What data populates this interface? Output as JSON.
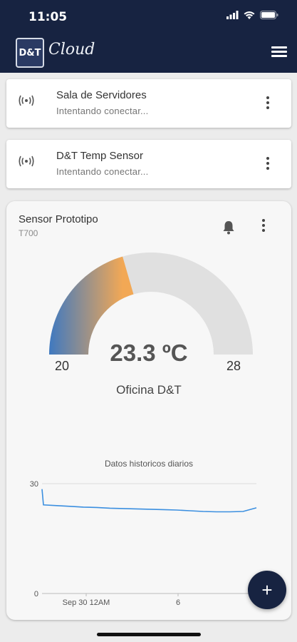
{
  "status_bar": {
    "time": "11:05"
  },
  "app": {
    "title": "Cloud",
    "logo_text": "D&T"
  },
  "devices": [
    {
      "name": "Sala de Servidores",
      "status": "Intentando conectar..."
    },
    {
      "name": "D&T Temp Sensor",
      "status": "Intentando conectar..."
    }
  ],
  "sensor": {
    "name": "Sensor Prototipo",
    "model": "T700",
    "gauge": {
      "min": "20",
      "max": "28",
      "value": "23.3 ºC",
      "fill_fraction": 0.41
    },
    "location": "Oficina D&T",
    "colors": {
      "gauge_cold": "#3f79c0",
      "gauge_warm": "#f2a855",
      "gauge_track": "#e0e0e0",
      "accent": "#172341"
    }
  },
  "chart_data": {
    "type": "line",
    "title": "Datos historicos diarios",
    "ylim": [
      0,
      30
    ],
    "y_ticks": [
      "30",
      "0"
    ],
    "x_ticks": [
      "Sep 30 12AM",
      "6"
    ],
    "series": [
      {
        "color": "#3b8fe0",
        "values": [
          28.5,
          24.2,
          24.0,
          23.8,
          23.6,
          23.5,
          23.3,
          23.2,
          23.1,
          23.0,
          22.9,
          22.8,
          22.6,
          22.4,
          22.3,
          22.3,
          22.4,
          23.4
        ]
      }
    ]
  },
  "fab": {
    "label": "+"
  }
}
